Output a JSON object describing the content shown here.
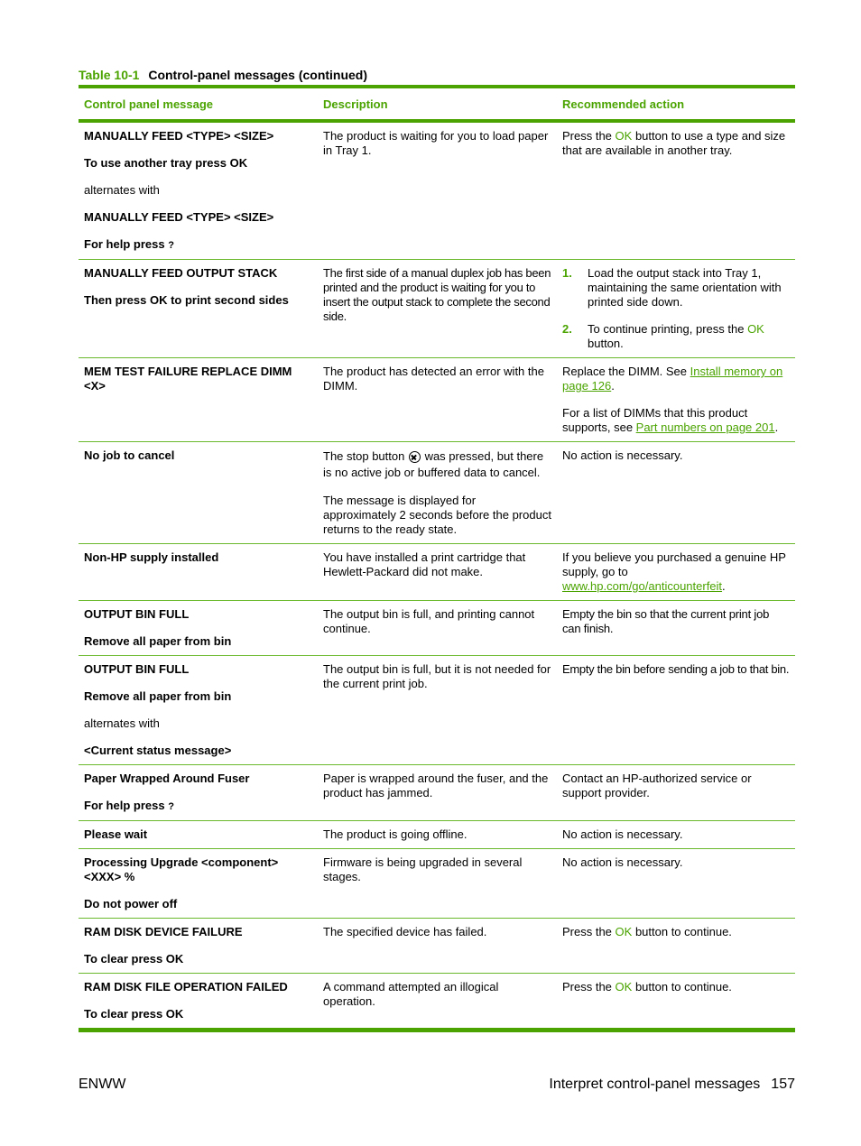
{
  "table": {
    "caption_number": "Table 10-1",
    "caption_title": "Control-panel messages (continued)",
    "headers": [
      "Control panel message",
      "Description",
      "Recommended action"
    ],
    "ok_label": "OK",
    "rows": [
      {
        "message": [
          "MANUALLY FEED <TYPE> <SIZE>",
          "To use another tray press OK",
          "alternates with",
          "MANUALLY FEED <TYPE> <SIZE>",
          "For help press"
        ],
        "help_glyph": "?",
        "description": [
          "The product is waiting for you to load paper in Tray 1."
        ],
        "action_pre": "Press the ",
        "action_post": " button to use a type and size that are available in another tray."
      },
      {
        "message": [
          "MANUALLY FEED OUTPUT STACK",
          "Then press OK to print second sides"
        ],
        "description": [
          "The first side of a manual duplex job has been printed and the product is waiting for you to insert the output stack to complete the second side."
        ],
        "steps": [
          {
            "n": "1.",
            "text": "Load the output stack into Tray 1, maintaining the same orientation with printed side down."
          },
          {
            "n": "2.",
            "pre": "To continue printing, press the ",
            "post": " button."
          }
        ]
      },
      {
        "message": [
          "MEM TEST FAILURE REPLACE DIMM <X>"
        ],
        "description": [
          "The product has detected an error with the DIMM."
        ],
        "action": [
          {
            "pre": "Replace the DIMM. See ",
            "link": "Install memory on page 126",
            "post": "."
          },
          {
            "pre": "For a list of DIMMs that this product supports, see ",
            "link": "Part numbers on page 201",
            "post": "."
          }
        ]
      },
      {
        "message": [
          "No job to cancel"
        ],
        "description_pre": "The stop button ",
        "description_post": " was pressed, but there is no active job or buffered data to cancel.",
        "description2": "The message is displayed for approximately 2 seconds before the product returns to the ready state.",
        "action": "No action is necessary."
      },
      {
        "message": [
          "Non-HP supply installed"
        ],
        "description": [
          "You have installed a print cartridge that Hewlett-Packard did not make."
        ],
        "action_pre": "If you believe you purchased a genuine HP supply, go to ",
        "action_link": "www.hp.com/go/anticounterfeit",
        "action_post": "."
      },
      {
        "message": [
          "OUTPUT BIN FULL",
          "Remove all paper from bin"
        ],
        "description": [
          "The output bin is full, and printing cannot continue."
        ],
        "action": "Empty the bin so that the current print job can finish."
      },
      {
        "message": [
          "OUTPUT BIN FULL",
          "Remove all paper from bin",
          "alternates with",
          "<Current status message>"
        ],
        "description": [
          "The output bin is full, but it is not needed for the current print job."
        ],
        "action": "Empty the bin before sending a job to that bin."
      },
      {
        "message": [
          "Paper Wrapped Around Fuser",
          "For help press"
        ],
        "help_glyph": "?",
        "description": [
          "Paper is wrapped around the fuser, and the product has jammed."
        ],
        "action": "Contact an HP-authorized service or support provider."
      },
      {
        "message": [
          "Please wait"
        ],
        "description": [
          "The product is going offline."
        ],
        "action": "No action is necessary."
      },
      {
        "message": [
          "Processing Upgrade <component> <XXX> %",
          "Do not power off"
        ],
        "description": [
          "Firmware is being upgraded in several stages."
        ],
        "action": "No action is necessary."
      },
      {
        "message": [
          "RAM DISK DEVICE FAILURE",
          "To clear press OK"
        ],
        "description": [
          "The specified device has failed."
        ],
        "action_pre": "Press the ",
        "action_post": " button to continue."
      },
      {
        "message": [
          "RAM DISK FILE OPERATION FAILED",
          "To clear press OK"
        ],
        "description": [
          "A command attempted an illogical operation."
        ],
        "action_pre": "Press the ",
        "action_post": " button to continue."
      }
    ]
  },
  "footer": {
    "left": "ENWW",
    "section": "Interpret control-panel messages",
    "page_number": "157"
  }
}
